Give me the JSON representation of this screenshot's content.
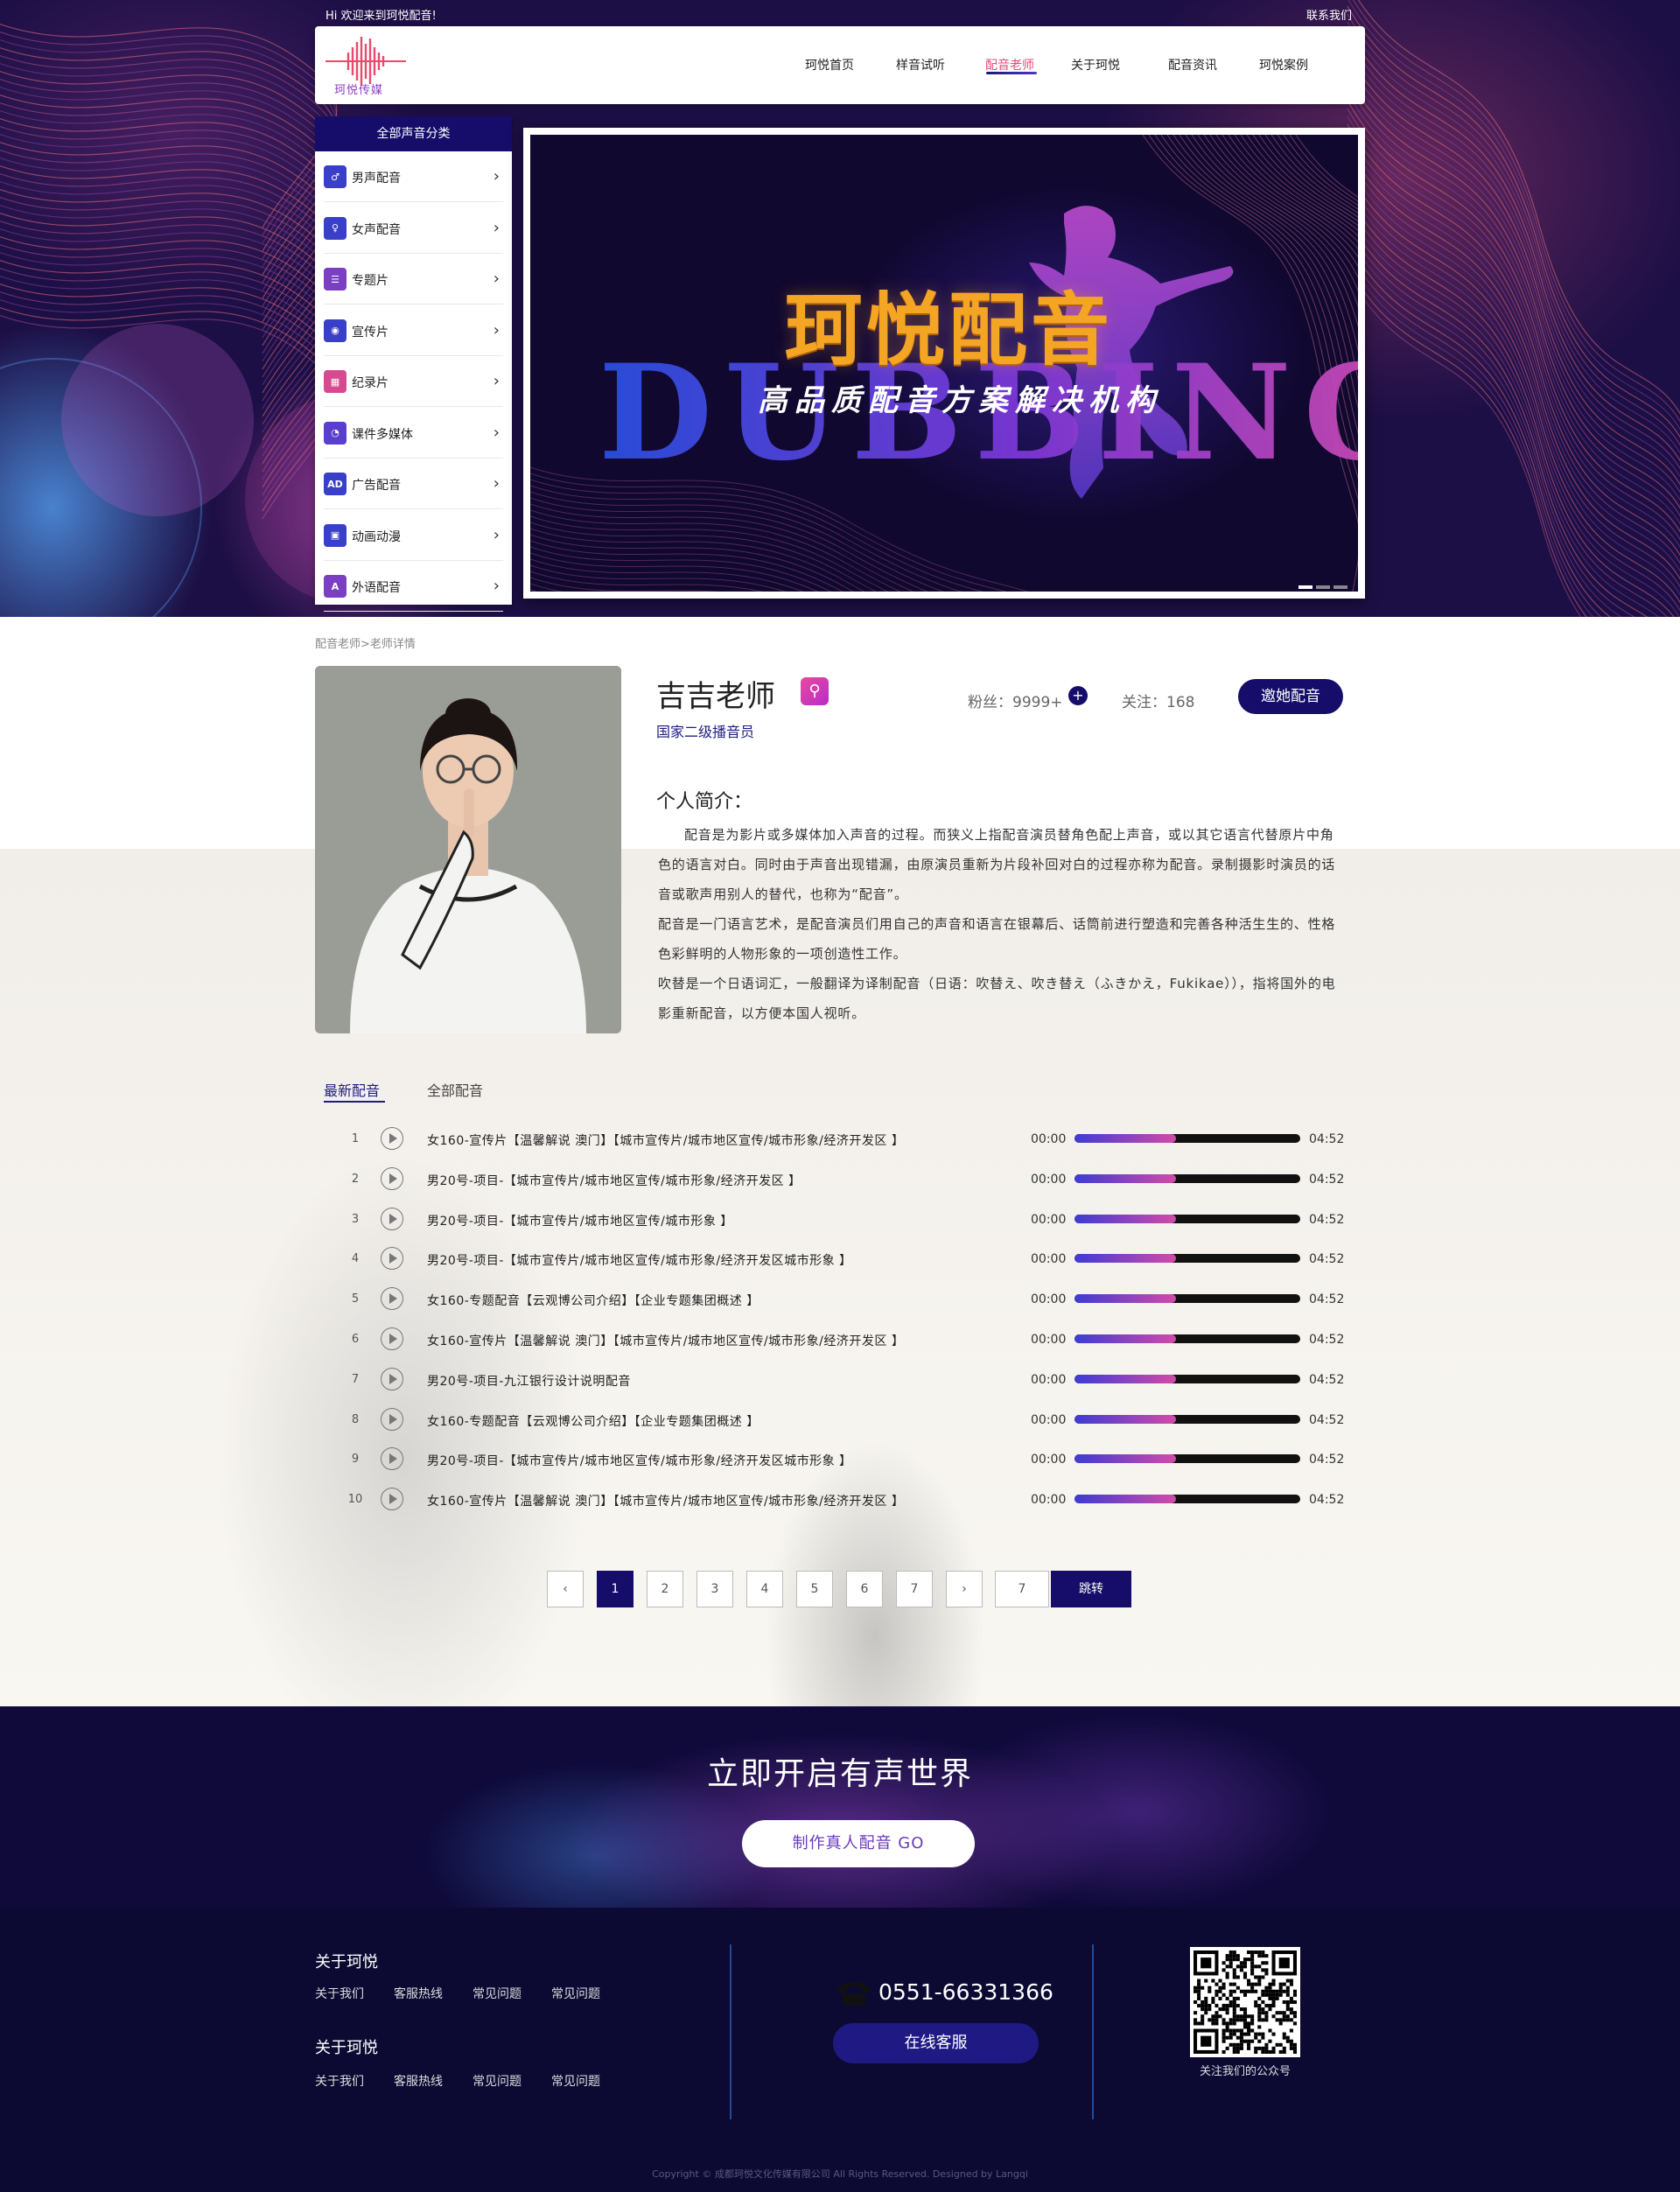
{
  "topbar": {
    "welcome": "Hi 欢迎来到珂悦配音!",
    "contact": "联系我们"
  },
  "logo": {
    "text": "珂悦传媒"
  },
  "nav": {
    "items": [
      {
        "label": "珂悦首页",
        "active": false
      },
      {
        "label": "样音试听",
        "active": false
      },
      {
        "label": "配音老师",
        "active": true
      },
      {
        "label": "关于珂悦",
        "active": false
      },
      {
        "label": "配音资讯",
        "active": false
      },
      {
        "label": "珂悦案例",
        "active": false
      }
    ]
  },
  "categories": {
    "title": "全部声音分类",
    "items": [
      {
        "label": "男声配音",
        "icon": "male-voice-icon",
        "color": "#3a3fc9"
      },
      {
        "label": "女声配音",
        "icon": "female-voice-icon",
        "color": "#3a3fc9"
      },
      {
        "label": "专题片",
        "icon": "document-icon",
        "color": "#7a3fc2"
      },
      {
        "label": "宣传片",
        "icon": "film-reel-icon",
        "color": "#3a3fc9"
      },
      {
        "label": "纪录片",
        "icon": "clapperboard-icon",
        "color": "#d84a8f"
      },
      {
        "label": "课件多媒体",
        "icon": "pacman-icon",
        "color": "#5a3fcf"
      },
      {
        "label": "广告配音",
        "icon": "ad-icon",
        "color": "#3a3fc9",
        "glyph": "AD"
      },
      {
        "label": "动画动漫",
        "icon": "video-camera-icon",
        "color": "#3a3fc9"
      },
      {
        "label": "外语配音",
        "icon": "foreign-language-icon",
        "color": "#7a3fc2",
        "glyph": "A"
      }
    ]
  },
  "banner": {
    "title": "珂悦配音",
    "english": "DUBBING",
    "subtitle": "高品质配音方案解决机构",
    "slide_count": 3,
    "active_slide": 1
  },
  "breadcrumb": "配音老师>老师详情",
  "teacher": {
    "name": "吉吉老师",
    "rank": "国家二级播音员",
    "fans": "粉丝：9999+",
    "follow": "关注：168",
    "invite_label": "邀她配音",
    "intro_title": "个人简介：",
    "intro_paragraphs": [
      "配音是为影片或多媒体加入声音的过程。而狭义上指配音演员替角色配上声音，或以其它语言代替原片中角色的语言对白。同时由于声音出现错漏，由原演员重新为片段补回对白的过程亦称为配音。录制摄影时演员的话音或歌声用别人的替代，也称为“配音”。",
      "配音是一门语言艺术，是配音演员们用自己的声音和语言在银幕后、话筒前进行塑造和完善各种活生生的、性格色彩鲜明的人物形象的一项创造性工作。",
      "吹替是一个日语词汇，一般翻译为译制配音（日语：吹替え、吹き替え（ふきかえ，Fukikae）），指将国外的电影重新配音，以方便本国人视听。"
    ]
  },
  "tabs": [
    {
      "label": "最新配音",
      "active": true
    },
    {
      "label": "全部配音",
      "active": false
    }
  ],
  "tracks": [
    {
      "num": "1",
      "title": "女160-宣传片【温馨解说 澳门】【城市宣传片/城市地区宣传/城市形象/经济开发区 】",
      "start": "00:00",
      "end": "04:52",
      "progress": 0.45
    },
    {
      "num": "2",
      "title": "男20号-项目-【城市宣传片/城市地区宣传/城市形象/经济开发区 】",
      "start": "00:00",
      "end": "04:52",
      "progress": 0.45
    },
    {
      "num": "3",
      "title": "男20号-项目-【城市宣传片/城市地区宣传/城市形象 】",
      "start": "00:00",
      "end": "04:52",
      "progress": 0.45
    },
    {
      "num": "4",
      "title": "男20号-项目-【城市宣传片/城市地区宣传/城市形象/经济开发区城市形象 】",
      "start": "00:00",
      "end": "04:52",
      "progress": 0.45
    },
    {
      "num": "5",
      "title": "女160-专题配音【云观博公司介绍】【企业专题集团概述 】",
      "start": "00:00",
      "end": "04:52",
      "progress": 0.45
    },
    {
      "num": "6",
      "title": "女160-宣传片【温馨解说 澳门】【城市宣传片/城市地区宣传/城市形象/经济开发区 】",
      "start": "00:00",
      "end": "04:52",
      "progress": 0.45
    },
    {
      "num": "7",
      "title": "男20号-项目-九江银行设计说明配音",
      "start": "00:00",
      "end": "04:52",
      "progress": 0.45
    },
    {
      "num": "8",
      "title": "女160-专题配音【云观博公司介绍】【企业专题集团概述 】",
      "start": "00:00",
      "end": "04:52",
      "progress": 0.45
    },
    {
      "num": "9",
      "title": "男20号-项目-【城市宣传片/城市地区宣传/城市形象/经济开发区城市形象 】",
      "start": "00:00",
      "end": "04:52",
      "progress": 0.45
    },
    {
      "num": "10",
      "title": "女160-宣传片【温馨解说 澳门】【城市宣传片/城市地区宣传/城市形象/经济开发区 】",
      "start": "00:00",
      "end": "04:52",
      "progress": 0.45
    }
  ],
  "pagination": {
    "prev": "‹",
    "pages": [
      "1",
      "2",
      "3",
      "4",
      "5",
      "6",
      "7"
    ],
    "current": "1",
    "next": "›",
    "jump_value": "7",
    "jump_label": "跳转"
  },
  "cta": {
    "title": "立即开启有声世界",
    "button": "制作真人配音  GO"
  },
  "footer": {
    "groups": [
      {
        "heading": "关于珂悦",
        "links": [
          "关于我们",
          "客服热线",
          "常见问题",
          "常见问题"
        ]
      },
      {
        "heading": "关于珂悦",
        "links": [
          "关于我们",
          "客服热线",
          "常见问题",
          "常见问题"
        ]
      }
    ],
    "phone": "0551-66331366",
    "service_button": "在线客服",
    "qr_caption": "关注我们的公众号",
    "copyright": "Copyright © 成都珂悦文化传媒有限公司 All Rights Reserved. Designed by Langqi"
  }
}
